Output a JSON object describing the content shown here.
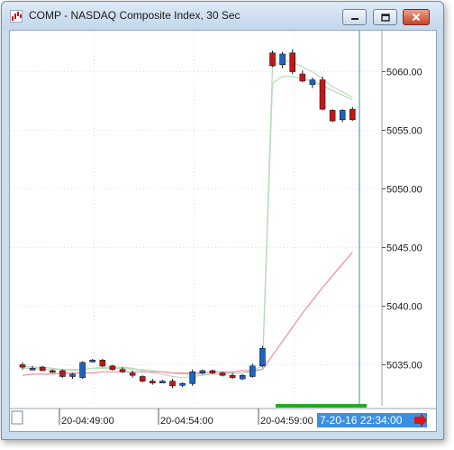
{
  "window": {
    "title": "COMP - NASDAQ Composite Index, 30 Sec"
  },
  "icons": {
    "app": "chart-app-icon",
    "minimize": "minimize-icon",
    "maximize": "maximize-icon",
    "close": "close-icon",
    "scroll": "red-arrow-right-icon"
  },
  "colors": {
    "up": "#1f62c0",
    "down": "#c01818",
    "ma_fast": "#b7dcb7",
    "ma_slow": "#f08aa8",
    "crosshair": "#3b89a6",
    "time_badge_bg": "#3a8fe0",
    "session_bar": "#22aa22"
  },
  "chart_data": {
    "type": "candlestick",
    "ylim": [
      5031.5,
      5063.5
    ],
    "y_ticks": [
      "5035.00",
      "5040.00",
      "5045.00",
      "5050.00",
      "5055.00",
      "5060.00"
    ],
    "x_tick_labels": [
      "20-04:49:00",
      "20-04:54:00",
      "20-04:59:00"
    ],
    "crosshair_time": "7-20-16 22:34:00",
    "grid": true,
    "candles": [
      {
        "o": 5035.0,
        "h": 5035.2,
        "l": 5034.6,
        "c": 5034.8
      },
      {
        "o": 5034.7,
        "h": 5034.9,
        "l": 5034.6,
        "c": 5034.7
      },
      {
        "o": 5034.8,
        "h": 5034.9,
        "l": 5034.5,
        "c": 5034.5
      },
      {
        "o": 5034.5,
        "h": 5034.6,
        "l": 5034.3,
        "c": 5034.4
      },
      {
        "o": 5034.5,
        "h": 5034.6,
        "l": 5033.9,
        "c": 5034.0
      },
      {
        "o": 5034.0,
        "h": 5034.3,
        "l": 5033.8,
        "c": 5034.2
      },
      {
        "o": 5033.9,
        "h": 5035.3,
        "l": 5033.8,
        "c": 5035.2
      },
      {
        "o": 5035.3,
        "h": 5035.5,
        "l": 5035.2,
        "c": 5035.4
      },
      {
        "o": 5035.4,
        "h": 5035.5,
        "l": 5034.8,
        "c": 5034.9
      },
      {
        "o": 5034.9,
        "h": 5035.0,
        "l": 5034.5,
        "c": 5034.6
      },
      {
        "o": 5034.6,
        "h": 5034.8,
        "l": 5034.3,
        "c": 5034.4
      },
      {
        "o": 5034.3,
        "h": 5034.5,
        "l": 5033.9,
        "c": 5034.1
      },
      {
        "o": 5034.0,
        "h": 5034.1,
        "l": 5033.5,
        "c": 5033.6
      },
      {
        "o": 5033.6,
        "h": 5033.8,
        "l": 5033.3,
        "c": 5033.5
      },
      {
        "o": 5033.6,
        "h": 5033.7,
        "l": 5033.5,
        "c": 5033.6
      },
      {
        "o": 5033.6,
        "h": 5033.8,
        "l": 5033.0,
        "c": 5033.2
      },
      {
        "o": 5033.3,
        "h": 5033.5,
        "l": 5033.1,
        "c": 5033.4
      },
      {
        "o": 5033.4,
        "h": 5034.6,
        "l": 5033.2,
        "c": 5034.4
      },
      {
        "o": 5034.3,
        "h": 5034.6,
        "l": 5034.2,
        "c": 5034.5
      },
      {
        "o": 5034.5,
        "h": 5034.6,
        "l": 5034.2,
        "c": 5034.3
      },
      {
        "o": 5034.3,
        "h": 5034.4,
        "l": 5034.0,
        "c": 5034.1
      },
      {
        "o": 5034.1,
        "h": 5034.3,
        "l": 5033.8,
        "c": 5033.9
      },
      {
        "o": 5033.8,
        "h": 5034.2,
        "l": 5033.7,
        "c": 5034.1
      },
      {
        "o": 5034.0,
        "h": 5035.1,
        "l": 5033.9,
        "c": 5034.9
      },
      {
        "o": 5034.9,
        "h": 5036.6,
        "l": 5034.8,
        "c": 5036.4
      },
      {
        "o": 5061.6,
        "h": 5061.8,
        "l": 5060.4,
        "c": 5060.5
      },
      {
        "o": 5060.6,
        "h": 5061.7,
        "l": 5060.3,
        "c": 5061.5
      },
      {
        "o": 5061.6,
        "h": 5061.9,
        "l": 5059.8,
        "c": 5060.0
      },
      {
        "o": 5059.8,
        "h": 5060.1,
        "l": 5059.1,
        "c": 5059.2
      },
      {
        "o": 5058.9,
        "h": 5059.5,
        "l": 5058.6,
        "c": 5059.3
      },
      {
        "o": 5059.3,
        "h": 5059.6,
        "l": 5056.7,
        "c": 5056.8
      },
      {
        "o": 5056.7,
        "h": 5056.8,
        "l": 5055.7,
        "c": 5055.8
      },
      {
        "o": 5055.9,
        "h": 5056.8,
        "l": 5055.7,
        "c": 5056.7
      },
      {
        "o": 5056.8,
        "h": 5057.0,
        "l": 5055.8,
        "c": 5055.9
      }
    ],
    "series": [
      {
        "values": [
          5034.9,
          5034.8,
          5034.8,
          5034.7,
          5034.6,
          5034.5,
          5034.6,
          5034.7,
          5034.8,
          5034.8,
          5034.8,
          5034.7,
          5034.5,
          5034.3,
          5034.2,
          5034.0,
          5033.9,
          5034.0,
          5034.1,
          5034.2,
          5034.3,
          5034.3,
          5034.3,
          5034.5,
          5034.9,
          5060.4,
          5061.0,
          5060.8,
          5060.4,
          5060.0,
          5059.4,
          5058.7,
          5058.3,
          5057.8
        ]
      },
      {
        "values": [
          5034.7,
          5034.7,
          5034.6,
          5034.6,
          5034.6,
          5034.6,
          5034.6,
          5034.7,
          5034.7,
          5034.7,
          5034.7,
          5034.6,
          5034.6,
          5034.5,
          5034.4,
          5034.3,
          5034.2,
          5034.2,
          5034.2,
          5034.2,
          5034.2,
          5034.3,
          5034.3,
          5034.4,
          5034.6,
          5059.0,
          5059.6,
          5059.6,
          5059.4,
          5059.2,
          5058.8,
          5058.4,
          5058.0,
          5057.6
        ]
      },
      {
        "values": [
          5034.1,
          5034.2,
          5034.2,
          5034.2,
          5034.3,
          5034.3,
          5034.3,
          5034.3,
          5034.4,
          5034.4,
          5034.4,
          5034.4,
          5034.4,
          5034.4,
          5034.4,
          5034.3,
          5034.3,
          5034.3,
          5034.3,
          5034.4,
          5034.4,
          5034.4,
          5034.5,
          5034.5,
          5034.6,
          5035.8,
          5037.0,
          5038.2,
          5039.4,
          5040.5,
          5041.6,
          5042.6,
          5043.6,
          5044.6
        ]
      }
    ]
  }
}
